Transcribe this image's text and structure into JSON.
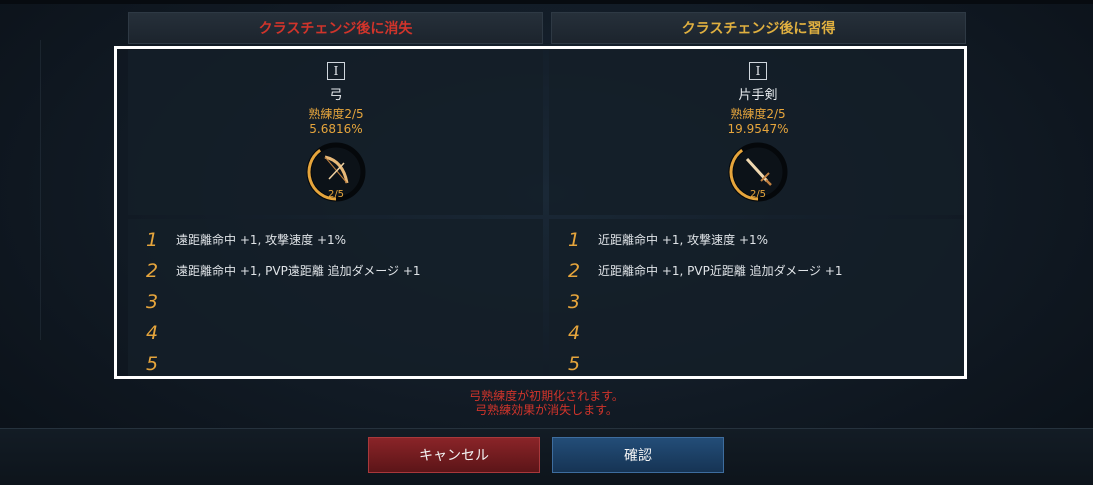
{
  "header": {
    "lost_label": "クラスチェンジ後に消失",
    "gain_label": "クラスチェンジ後に習得"
  },
  "left_weapon": {
    "rank": "I",
    "name": "弓",
    "proficiency": "熟練度2/5",
    "percent": "5.6816%",
    "level": "2/5",
    "progress_fraction": 0.4,
    "icon": "bow-icon",
    "bonuses": [
      {
        "num": "1",
        "text": "遠距離命中 +1, 攻撃速度 +1%"
      },
      {
        "num": "2",
        "text": "遠距離命中 +1, PVP遠距離 追加ダメージ +1"
      },
      {
        "num": "3",
        "text": ""
      },
      {
        "num": "4",
        "text": ""
      },
      {
        "num": "5",
        "text": ""
      }
    ]
  },
  "right_weapon": {
    "rank": "I",
    "name": "片手剣",
    "proficiency": "熟練度2/5",
    "percent": "19.9547%",
    "level": "2/5",
    "progress_fraction": 0.4,
    "icon": "sword-icon",
    "bonuses": [
      {
        "num": "1",
        "text": "近距離命中 +1, 攻撃速度 +1%"
      },
      {
        "num": "2",
        "text": "近距離命中 +1, PVP近距離 追加ダメージ +1"
      },
      {
        "num": "3",
        "text": ""
      },
      {
        "num": "4",
        "text": ""
      },
      {
        "num": "5",
        "text": ""
      }
    ]
  },
  "warning": {
    "line1": "弓熟練度が初期化されます。",
    "line2": "弓熟練効果が消失します。"
  },
  "buttons": {
    "cancel": "キャンセル",
    "confirm": "確認"
  },
  "colors": {
    "lost": "#d0342b",
    "gain": "#e0b040",
    "accent": "#e6a53c"
  }
}
